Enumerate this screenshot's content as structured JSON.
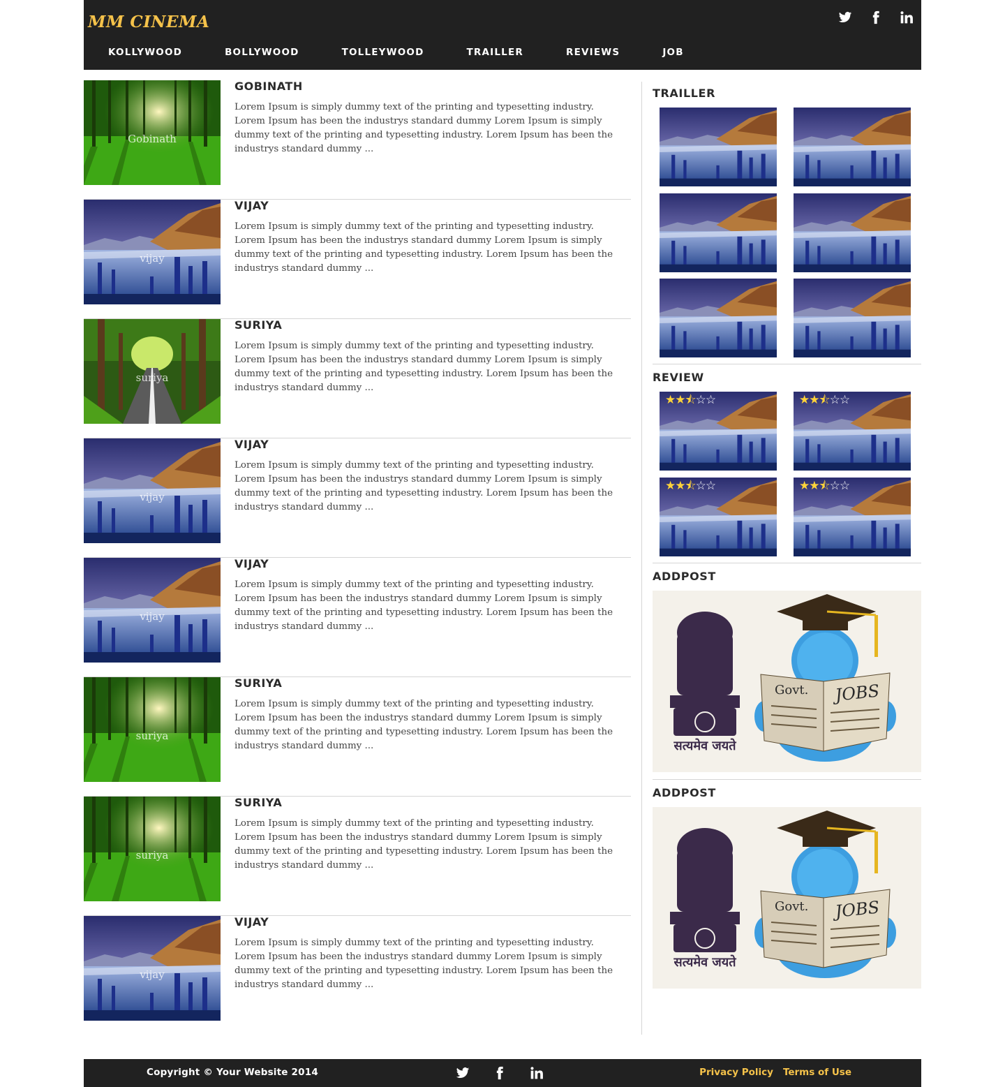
{
  "header": {
    "logo": "MM CINEMA",
    "nav": [
      "KOLLYWOOD",
      "BOLLYWOOD",
      "TOLLEYWOOD",
      "TRAILLER",
      "REVIEWS",
      "JOB"
    ],
    "social_icons": [
      "twitter-icon",
      "facebook-icon",
      "linkedin-icon"
    ]
  },
  "posts": [
    {
      "title": "GOBINATH",
      "caption": "Gobinath",
      "image": "forest",
      "text": "Lorem Ipsum is simply dummy text of the printing and typesetting industry. Lorem Ipsum has been the industrys standard dummy Lorem Ipsum is simply dummy text of the printing and typesetting industry. Lorem Ipsum has been the industrys standard dummy ..."
    },
    {
      "title": "VIJAY",
      "caption": "vijay",
      "image": "lake",
      "text": "Lorem Ipsum is simply dummy text of the printing and typesetting industry. Lorem Ipsum has been the industrys standard dummy Lorem Ipsum is simply dummy text of the printing and typesetting industry. Lorem Ipsum has been the industrys standard dummy ..."
    },
    {
      "title": "SURIYA",
      "caption": "suriya",
      "image": "road",
      "text": "Lorem Ipsum is simply dummy text of the printing and typesetting industry. Lorem Ipsum has been the industrys standard dummy Lorem Ipsum is simply dummy text of the printing and typesetting industry. Lorem Ipsum has been the industrys standard dummy ..."
    },
    {
      "title": "VIJAY",
      "caption": "vijay",
      "image": "lake",
      "text": "Lorem Ipsum is simply dummy text of the printing and typesetting industry. Lorem Ipsum has been the industrys standard dummy Lorem Ipsum is simply dummy text of the printing and typesetting industry. Lorem Ipsum has been the industrys standard dummy ..."
    },
    {
      "title": "VIJAY",
      "caption": "vijay",
      "image": "lake",
      "text": "Lorem Ipsum is simply dummy text of the printing and typesetting industry. Lorem Ipsum has been the industrys standard dummy Lorem Ipsum is simply dummy text of the printing and typesetting industry. Lorem Ipsum has been the industrys standard dummy ..."
    },
    {
      "title": "SURIYA",
      "caption": "suriya",
      "image": "forest",
      "text": "Lorem Ipsum is simply dummy text of the printing and typesetting industry. Lorem Ipsum has been the industrys standard dummy Lorem Ipsum is simply dummy text of the printing and typesetting industry. Lorem Ipsum has been the industrys standard dummy ..."
    },
    {
      "title": "SURIYA",
      "caption": "suriya",
      "image": "forest",
      "text": "Lorem Ipsum is simply dummy text of the printing and typesetting industry. Lorem Ipsum has been the industrys standard dummy Lorem Ipsum is simply dummy text of the printing and typesetting industry. Lorem Ipsum has been the industrys standard dummy ..."
    },
    {
      "title": "VIJAY",
      "caption": "vijay",
      "image": "lake",
      "text": "Lorem Ipsum is simply dummy text of the printing and typesetting industry. Lorem Ipsum has been the industrys standard dummy Lorem Ipsum is simply dummy text of the printing and typesetting industry. Lorem Ipsum has been the industrys standard dummy ..."
    }
  ],
  "sidebar": {
    "trailer_title": "TRAILLER",
    "review_title": "REVIEW",
    "review_ratings": [
      2.5,
      2.5,
      2.5,
      2.5
    ],
    "rating_max": 5,
    "ad_title_1": "ADDPOST",
    "ad_title_2": "ADDPOST",
    "ad_text_govt": "Govt.",
    "ad_text_jobs": "JOBS",
    "ad_motto": "सत्यमेव जयते"
  },
  "footer": {
    "copyright": "Copyright © Your Website 2014",
    "links": [
      "Privacy Policy",
      "Terms of Use"
    ]
  },
  "colors": {
    "header_bg": "#212121",
    "accent": "#f5c24a",
    "star": "#ffd33a"
  }
}
